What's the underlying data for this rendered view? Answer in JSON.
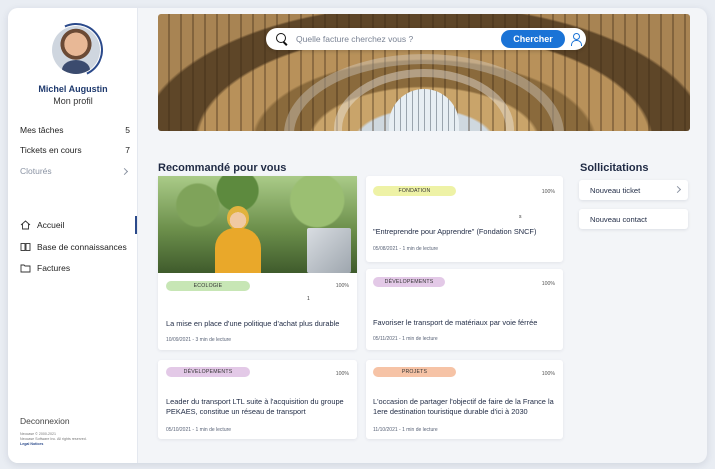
{
  "user": {
    "name": "Michel Augustin",
    "profile_label": "Mon profil"
  },
  "stats": [
    {
      "label": "Mes tâches",
      "value": "5"
    },
    {
      "label": "Tickets en cours",
      "value": "7"
    },
    {
      "label": "Cloturés",
      "value": ""
    }
  ],
  "nav": [
    {
      "label": "Accueil",
      "icon": "home-icon",
      "active": true
    },
    {
      "label": "Base de connaissances",
      "icon": "book-icon",
      "active": false
    },
    {
      "label": "Factures",
      "icon": "folder-icon",
      "active": false
    }
  ],
  "footer": {
    "logout": "Deconnexion",
    "copyright": "Neocase © 2000-2021",
    "rights": "Neocase Software Inc. All rights reserved.",
    "legal": "Legal Notices"
  },
  "search": {
    "placeholder": "Quelle facture cherchez vous ?",
    "button": "Chercher"
  },
  "recommended": {
    "title": "Recommandé pour vous",
    "cards": [
      {
        "tag": "ECOLOGIE",
        "tag_color": "#c7e6b5",
        "pct": "100%",
        "dot": "1",
        "title": "La mise en place d'une politique d'achat plus durable",
        "meta": "10/09/2021 - 3 min de lecture"
      },
      {
        "tag": "FONDATION",
        "tag_color": "#eef2a6",
        "pct": "100%",
        "dot": "s",
        "title": "\"Entreprendre pour Apprendre\" (Fondation SNCF)",
        "meta": "05/08/2021 - 1 min de lecture"
      },
      {
        "tag": "DÉVELOPEMENTS",
        "tag_color": "#e3c9e7",
        "pct": "100%",
        "title": "Favoriser le transport de matériaux par voie férrée",
        "meta": "05/11/2021 - 1 min de lecture"
      },
      {
        "tag": "DÉVELOPEMENTS",
        "tag_color": "#e3c9e7",
        "pct": "100%",
        "title": "Leader du transport LTL suite à l'acquisition du groupe PEKAES, constitue un réseau de transport",
        "meta": "05/10/2021 - 1 min de lecture"
      },
      {
        "tag": "PROJETS",
        "tag_color": "#f6c3a6",
        "pct": "100%",
        "title": "L'occasion de partager l'objectif de faire de la France la 1ere destination touristique durable d'ici à 2030",
        "meta": "11/10/2021 - 1 min de lecture"
      }
    ]
  },
  "solicitations": {
    "title": "Sollicitations",
    "items": [
      {
        "label": "Nouveau ticket"
      },
      {
        "label": "Nouveau contact"
      }
    ]
  }
}
